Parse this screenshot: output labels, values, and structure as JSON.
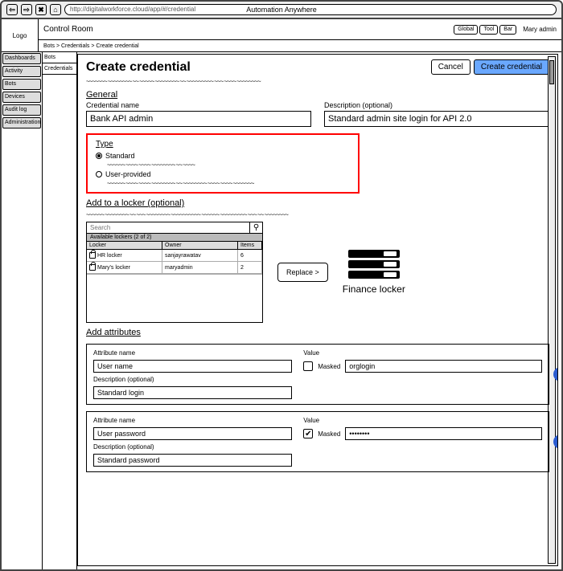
{
  "browser": {
    "title": "Automation Anywhere",
    "url": "http://digitalworkforce.cloud/app/#/credential"
  },
  "logo": "Logo",
  "control_room": "Control Room",
  "pills": {
    "global": "Global",
    "tool": "Tool",
    "bar": "Bar"
  },
  "user": "Mary admin",
  "breadcrumb": "Bots > Credentials > Create credential",
  "left_nav": [
    "Dashboards",
    "Activity",
    "Bots",
    "Devices",
    "Audit log",
    "Administration"
  ],
  "subtabs": {
    "bots": "Bots",
    "credentials": "Credentials"
  },
  "page": {
    "title": "Create credential",
    "cancel": "Cancel",
    "create": "Create credential"
  },
  "general": {
    "heading": "General",
    "cred_name_label": "Credential name",
    "cred_name_value": "Bank API admin",
    "desc_label": "Description (optional)",
    "desc_value": "Standard admin site login for API 2.0"
  },
  "type": {
    "heading": "Type",
    "standard": "Standard",
    "user_provided": "User-provided"
  },
  "locker": {
    "heading": "Add to a locker (optional)",
    "search_placeholder": "Search",
    "available_label": "Available lockers (2 of 2)",
    "cols": {
      "locker": "Locker",
      "owner": "Owner",
      "items": "Items"
    },
    "rows": [
      {
        "name": "HR locker",
        "owner": "sanjayrawatav",
        "items": "6"
      },
      {
        "name": "Mary's locker",
        "owner": "maryadmin",
        "items": "2"
      }
    ],
    "replace": "Replace >",
    "selected_name": "Finance locker"
  },
  "attributes": {
    "heading": "Add attributes",
    "attr_name_label": "Attribute name",
    "desc_label": "Description (optional)",
    "value_label": "Value",
    "masked_label": "Masked",
    "row1": {
      "name": "User name",
      "desc": "Standard login",
      "masked": false,
      "value": "orglogin"
    },
    "row2": {
      "name": "User password",
      "desc": "Standard password",
      "masked": true,
      "value": "••••••••"
    }
  }
}
